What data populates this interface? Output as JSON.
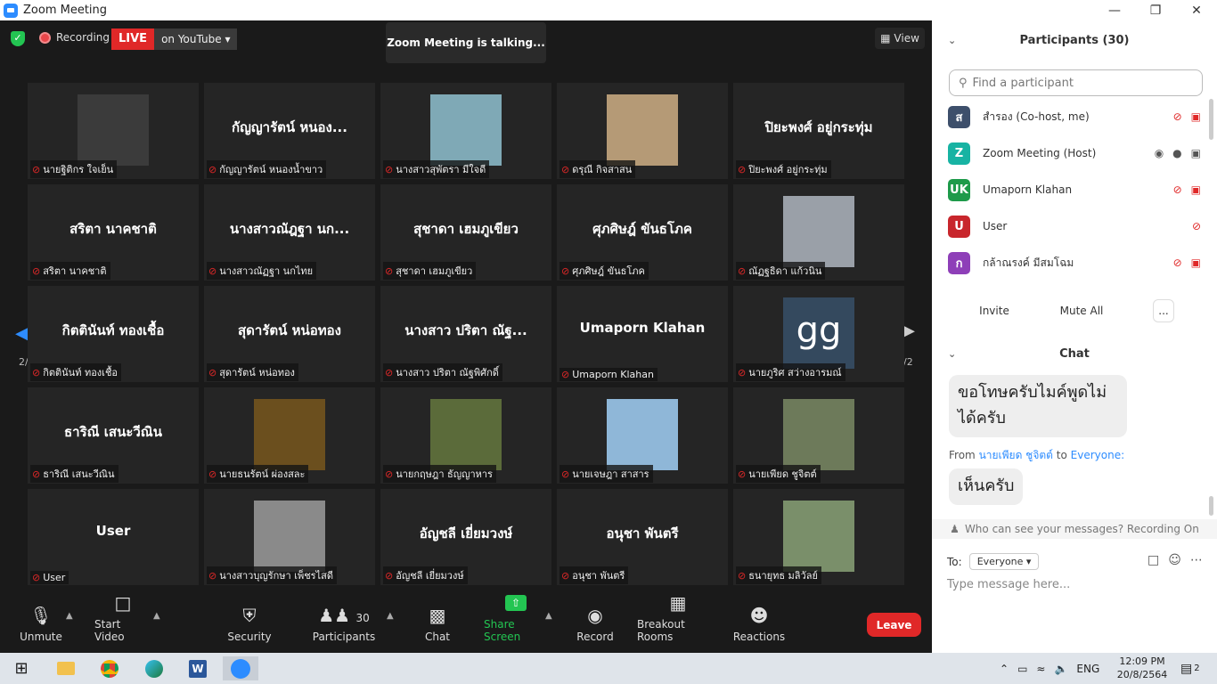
{
  "window": {
    "title": "Zoom Meeting"
  },
  "topbar": {
    "recording_label": "Recording",
    "live_badge": "LIVE",
    "live_target": "on YouTube",
    "talking": "Zoom Meeting is talking...",
    "view_label": "View"
  },
  "pager": {
    "left": "2/2",
    "right": "2/2"
  },
  "tiles": [
    {
      "display": "",
      "label": "นายฐิติกร ใจเย็น",
      "photo": true,
      "photo_color": "#3b3b3b"
    },
    {
      "display": "กัญญารัตน์ หนอง...",
      "label": "กัญญารัตน์ หนองน้ำขาว",
      "photo": false
    },
    {
      "display": "",
      "label": "นางสาวสุพัตรา มีใจดี",
      "photo": true,
      "photo_color": "#7fa9b6"
    },
    {
      "display": "",
      "label": "ดรุณี กิจสาสน",
      "photo": true,
      "photo_color": "#b59a76"
    },
    {
      "display": "ปิยะพงศ์ อยู่กระทุ่ม",
      "label": "ปิยะพงศ์ อยู่กระทุ่ม",
      "photo": false
    },
    {
      "display": "สริตา  นาคชาติ",
      "label": "สริตา  นาคชาติ",
      "photo": false
    },
    {
      "display": "นางสาวณัฎฐา นก...",
      "label": "นางสาวณัฏฐา นกไทย",
      "photo": false
    },
    {
      "display": "สุชาดา เฮมภูเขียว",
      "label": "สุชาดา เฮมภูเขียว",
      "photo": false
    },
    {
      "display": "ศุภศิษฎ์ ขันธโภค",
      "label": "ศุภศิษฎ์ ขันธโภค",
      "photo": false
    },
    {
      "display": "",
      "label": "ณัฏฐธิดา แก้วนิน",
      "photo": true,
      "photo_color": "#9aa0a8"
    },
    {
      "display": "กิตตินันท์ ทองเชื้อ",
      "label": "กิตตินันท์ ทองเชื้อ",
      "photo": false
    },
    {
      "display": "สุดารัตน์ หน่อทอง",
      "label": "สุดารัตน์ หน่อทอง",
      "photo": false
    },
    {
      "display": "นางสาว ปริตา ณัฐ...",
      "label": "นางสาว ปริตา ณัฐพิศักดิ์",
      "photo": false
    },
    {
      "display": "Umaporn Klahan",
      "label": "Umaporn Klahan",
      "photo": false
    },
    {
      "display": "",
      "label": "นายภูริศ สว่างอารมณ์",
      "photo": true,
      "photo_color": "#34495e",
      "photo_text": "gg"
    },
    {
      "display": "ธาริณี เสนะวีณิน",
      "label": "ธาริณี เสนะวีณิน",
      "photo": false
    },
    {
      "display": "",
      "label": "นายธนรัตน์ ผ่องสละ",
      "photo": true,
      "photo_color": "#6b4f1e"
    },
    {
      "display": "",
      "label": "นายกฤษฎา ธัญญาหาร",
      "photo": true,
      "photo_color": "#5b6b3a"
    },
    {
      "display": "",
      "label": "นายเจษฎา สาสาร",
      "photo": true,
      "photo_color": "#8fb7d8"
    },
    {
      "display": "",
      "label": "นายเพียด ชูจิตต์",
      "photo": true,
      "photo_color": "#6d7a5a"
    },
    {
      "display": "User",
      "label": "User",
      "photo": false
    },
    {
      "display": "",
      "label": "นางสาวบุญรักษา เพ็ชรไสดี",
      "photo": true,
      "photo_color": "#8a8a8a"
    },
    {
      "display": "อัญชลี เยี่ยมวงษ์",
      "label": "อัญชลี เยี่ยมวงษ์",
      "photo": false
    },
    {
      "display": "อนุชา พันตรี",
      "label": "อนุชา พันตรี",
      "photo": false
    },
    {
      "display": "",
      "label": "ธนายุทธ มลิวัลย์",
      "photo": true,
      "photo_color": "#7a8f6a"
    }
  ],
  "toolbar": {
    "unmute": "Unmute",
    "start_video": "Start Video",
    "security": "Security",
    "participants": "Participants",
    "participants_count": "30",
    "chat": "Chat",
    "share_screen": "Share Screen",
    "record": "Record",
    "breakout": "Breakout Rooms",
    "reactions": "Reactions",
    "leave": "Leave"
  },
  "participants_panel": {
    "title": "Participants (30)",
    "search_placeholder": "Find a participant",
    "list": [
      {
        "initial": "ส",
        "name": "สำรอง (Co-host, me)",
        "color": "#3d4f6b"
      },
      {
        "initial": "Z",
        "name": "Zoom Meeting (Host)",
        "color": "#17b3a3"
      },
      {
        "initial": "UK",
        "name": "Umaporn Klahan",
        "color": "#1e9a4a"
      },
      {
        "initial": "U",
        "name": "User",
        "color": "#c8262c"
      },
      {
        "initial": "ก",
        "name": "กล้าณรงค์ มีสมโฉม",
        "color": "#8e3fb8"
      }
    ],
    "invite": "Invite",
    "mute_all": "Mute All",
    "more": "..."
  },
  "chat": {
    "title": "Chat",
    "msg1": "ขอโทษครับไมค์พูดไม่ได้ครับ",
    "from_prefix": "From",
    "from_name": "นายเพียด ชูจิตต์",
    "from_to": "to",
    "from_target": "Everyone:",
    "msg2": "เห็นครับ",
    "who_can_see": "Who can see your messages? Recording On",
    "to_label": "To:",
    "to_value": "Everyone",
    "placeholder": "Type message here..."
  },
  "taskbar": {
    "lang": "ENG",
    "time": "12:09 PM",
    "date": "20/8/2564",
    "notif": "2"
  }
}
